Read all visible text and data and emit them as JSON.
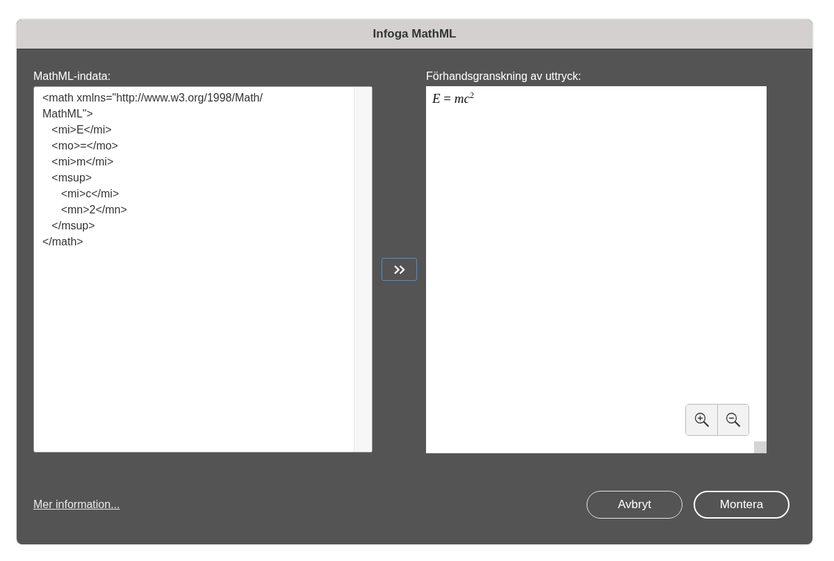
{
  "window": {
    "title": "Infoga MathML"
  },
  "input": {
    "label": "MathML-indata:",
    "lines": [
      "<math xmlns=\"http://www.w3.org/1998/Math/",
      "MathML\">",
      "   <mi>E</mi>",
      "   <mo>=</mo>",
      "   <mi>m</mi>",
      "   <msup>",
      "      <mi>c</mi>",
      "      <mn>2</mn>",
      "   </msup>",
      "</math>"
    ]
  },
  "preview": {
    "label": "Förhandsgranskning av uttryck:",
    "formula": "*E* = *mc*$^{2}$"
  },
  "footer": {
    "link": "Mer information...",
    "buttons": [
      {
        "label": "Avbryt",
        "kind": "secondary"
      },
      {
        "label": "Montera",
        "kind": "primary"
      }
    ]
  }
}
